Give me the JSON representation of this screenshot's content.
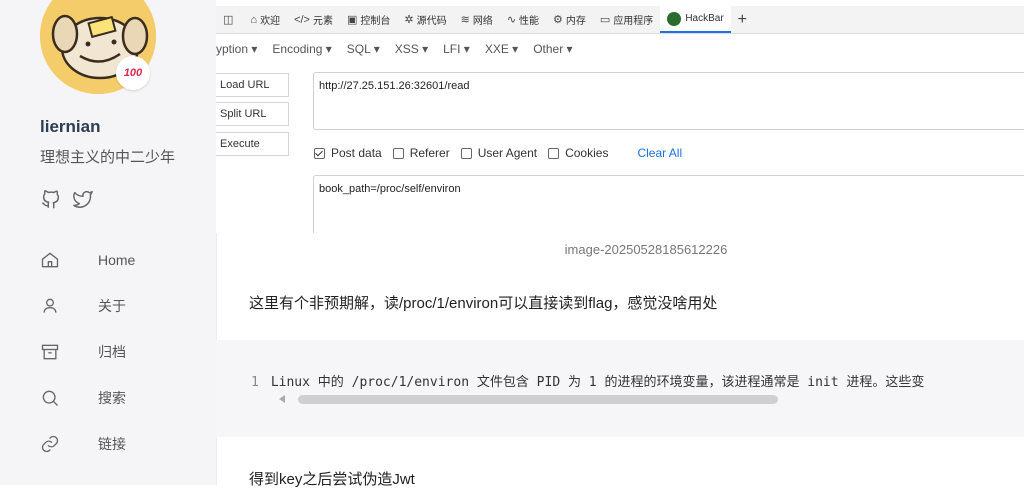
{
  "sidebar": {
    "name": "liernian",
    "bio": "理想主义的中二少年",
    "badge": "100",
    "nav": [
      {
        "label": "Home",
        "icon": "home-icon"
      },
      {
        "label": "关于",
        "icon": "user-icon"
      },
      {
        "label": "归档",
        "icon": "archive-icon"
      },
      {
        "label": "搜索",
        "icon": "search-icon"
      },
      {
        "label": "链接",
        "icon": "link-icon"
      }
    ]
  },
  "screenshot": {
    "devtools_tabs": [
      "欢迎",
      "元素",
      "控制台",
      "源代码",
      "网络",
      "性能",
      "内存",
      "应用程序",
      "HackBar"
    ],
    "plus": "+",
    "menu": [
      "yption ▾",
      "Encoding ▾",
      "SQL ▾",
      "XSS ▾",
      "LFI ▾",
      "XXE ▾",
      "Other ▾"
    ],
    "buttons": [
      "Load URL",
      "Split URL",
      "Execute"
    ],
    "url": "http://27.25.151.26:32601/read",
    "checkboxes": [
      {
        "label": "Post data",
        "checked": true
      },
      {
        "label": "Referer",
        "checked": false
      },
      {
        "label": "User Agent",
        "checked": false
      },
      {
        "label": "Cookies",
        "checked": false
      }
    ],
    "clear_all": "Clear All",
    "post_data": "book_path=/proc/self/environ"
  },
  "article": {
    "caption": "image-20250528185612226",
    "para1": "这里有个非预期解，读/proc/1/environ可以直接读到flag，感觉没啥用处",
    "code_line_number": "1",
    "code_text": "Linux 中的 /proc/1/environ 文件包含 PID 为 1 的进程的环境变量，该进程通常是 init 进程。这些变",
    "para2": "得到key之后尝试伪造Jwt"
  }
}
